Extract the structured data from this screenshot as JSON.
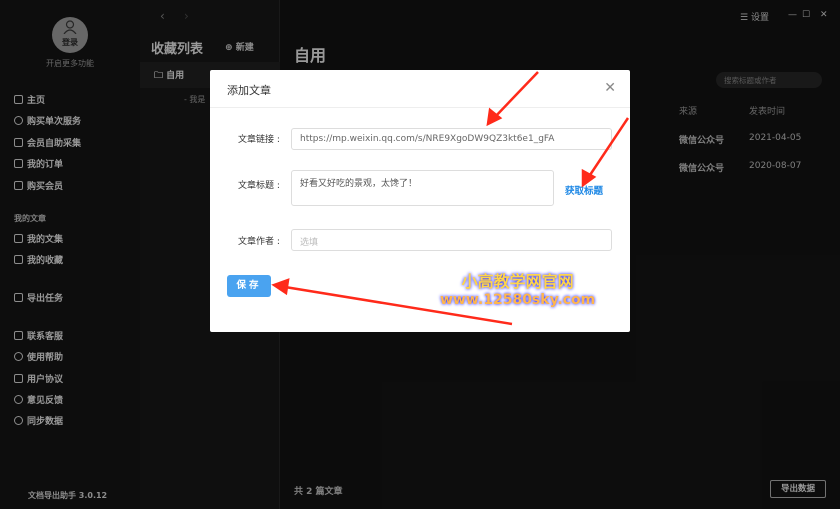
{
  "sidebar": {
    "login": "登录",
    "more": "开启更多功能",
    "items": [
      {
        "label": "主页"
      },
      {
        "label": "购买单次服务"
      },
      {
        "label": "会员自助采集"
      },
      {
        "label": "我的订单"
      },
      {
        "label": "购买会员"
      }
    ],
    "section": "我的文章",
    "items2": [
      {
        "label": "我的文集"
      },
      {
        "label": "我的收藏"
      }
    ],
    "export_task": "导出任务",
    "items3": [
      {
        "label": "联系客服"
      },
      {
        "label": "使用帮助"
      },
      {
        "label": "用户协议"
      },
      {
        "label": "意见反馈"
      },
      {
        "label": "同步数据"
      }
    ],
    "version": "文档导出助手 3.0.12"
  },
  "collections": {
    "title": "收藏列表",
    "new": "新建",
    "folder": "自用",
    "sub": "- 我是"
  },
  "topbar": {
    "settings": "设置"
  },
  "main": {
    "title": "自用",
    "search_placeholder": "搜索标题或作者",
    "columns": {
      "source": "来源",
      "date": "发表时间"
    },
    "rows": [
      {
        "source": "微信公众号",
        "date": "2021-04-05"
      },
      {
        "source": "微信公众号",
        "date": "2020-08-07"
      }
    ],
    "footer": "共 2 篇文章",
    "export": "导出数据"
  },
  "dialog": {
    "title": "添加文章",
    "link_label": "文章链接",
    "link_value": "https://mp.weixin.qq.com/s/NRE9XgoDW9QZ3kt6e1_gFA",
    "title_label": "文章标题",
    "title_value": "好看又好吃的景观，太馋了！",
    "fetch": "获取标题",
    "author_label": "文章作者",
    "author_placeholder": "选填",
    "save": "保存"
  },
  "watermark": {
    "line1": "小高教学网官网",
    "line2": "www.12580sky.com"
  },
  "colors": {
    "accent": "#4aa3f0",
    "link": "#1e88e5",
    "arrow": "#ff2a1a"
  }
}
